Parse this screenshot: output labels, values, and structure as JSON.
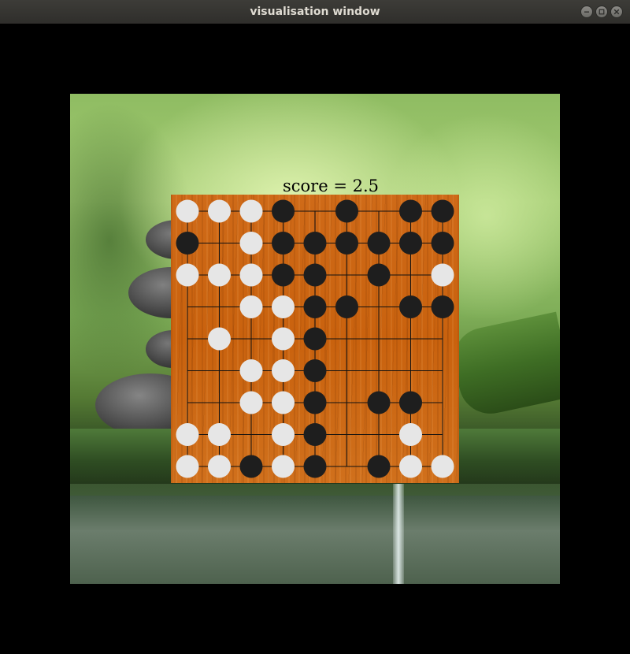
{
  "window": {
    "title": "visualisation window",
    "buttons": [
      "minimize-icon",
      "maximize-icon",
      "close-icon"
    ]
  },
  "game": {
    "score_text": "score = 2.5",
    "board_size": 9,
    "board": [
      "WWWB.B.BB",
      "B.WBBBBBB",
      "WWWBB.B.W",
      "..WWBB.BB",
      ".W.WB....",
      "..WWB....",
      "..WWB.BB.",
      "WW.WB..W.",
      "WWBWB.BWW"
    ],
    "colors": {
      "black_stone": "#1e1e1e",
      "white_stone": "#e6e6e6",
      "grid_line": "#111111",
      "board_wood": "#c9620e"
    }
  }
}
